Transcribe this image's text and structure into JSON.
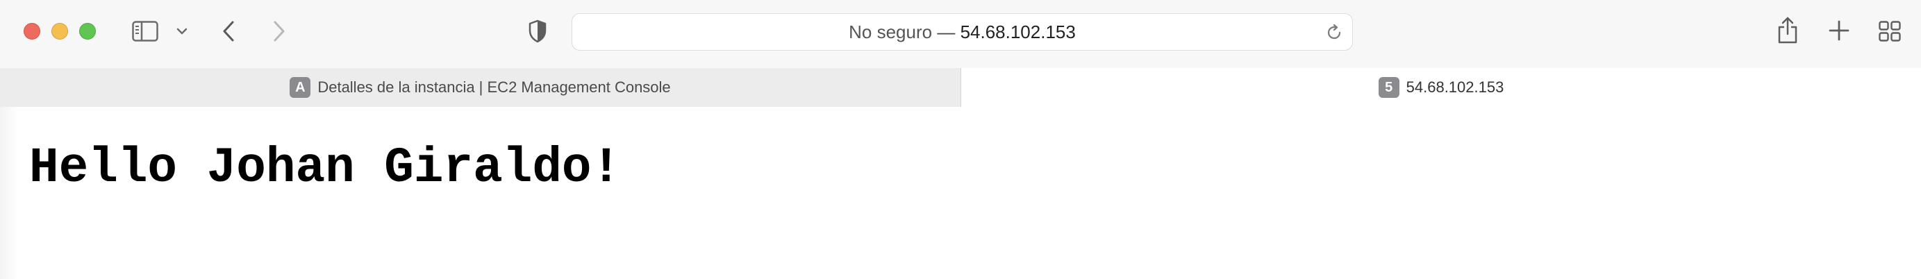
{
  "window": {
    "controls": {
      "close": "close-window",
      "minimize": "minimize-window",
      "zoom": "zoom-window"
    }
  },
  "toolbar": {
    "icons": {
      "sidebar": "sidebar-icon",
      "tab_group_menu": "chevron-down-icon",
      "back": "chevron-left-icon",
      "forward": "chevron-right-icon",
      "privacy": "shield-icon",
      "share": "share-icon",
      "new_tab": "plus-icon",
      "tab_overview": "grid-icon"
    },
    "address": {
      "security_label": "No seguro",
      "separator": " — ",
      "host": "54.68.102.153",
      "reload_icon": "reload-icon"
    }
  },
  "tabs": [
    {
      "badge": "A",
      "title": "Detalles de la instancia | EC2 Management Console",
      "active": false
    },
    {
      "badge": "5",
      "title": "54.68.102.153",
      "active": true
    }
  ],
  "page": {
    "heading": "Hello Johan Giraldo!"
  },
  "colors": {
    "close": "#ed6a5e",
    "minimize": "#f5bf4f",
    "zoom": "#61c554",
    "toolbar_bg": "#f7f7f7",
    "inactive_tab_bg": "#ececec",
    "badge_bg": "#8a8a8f"
  }
}
